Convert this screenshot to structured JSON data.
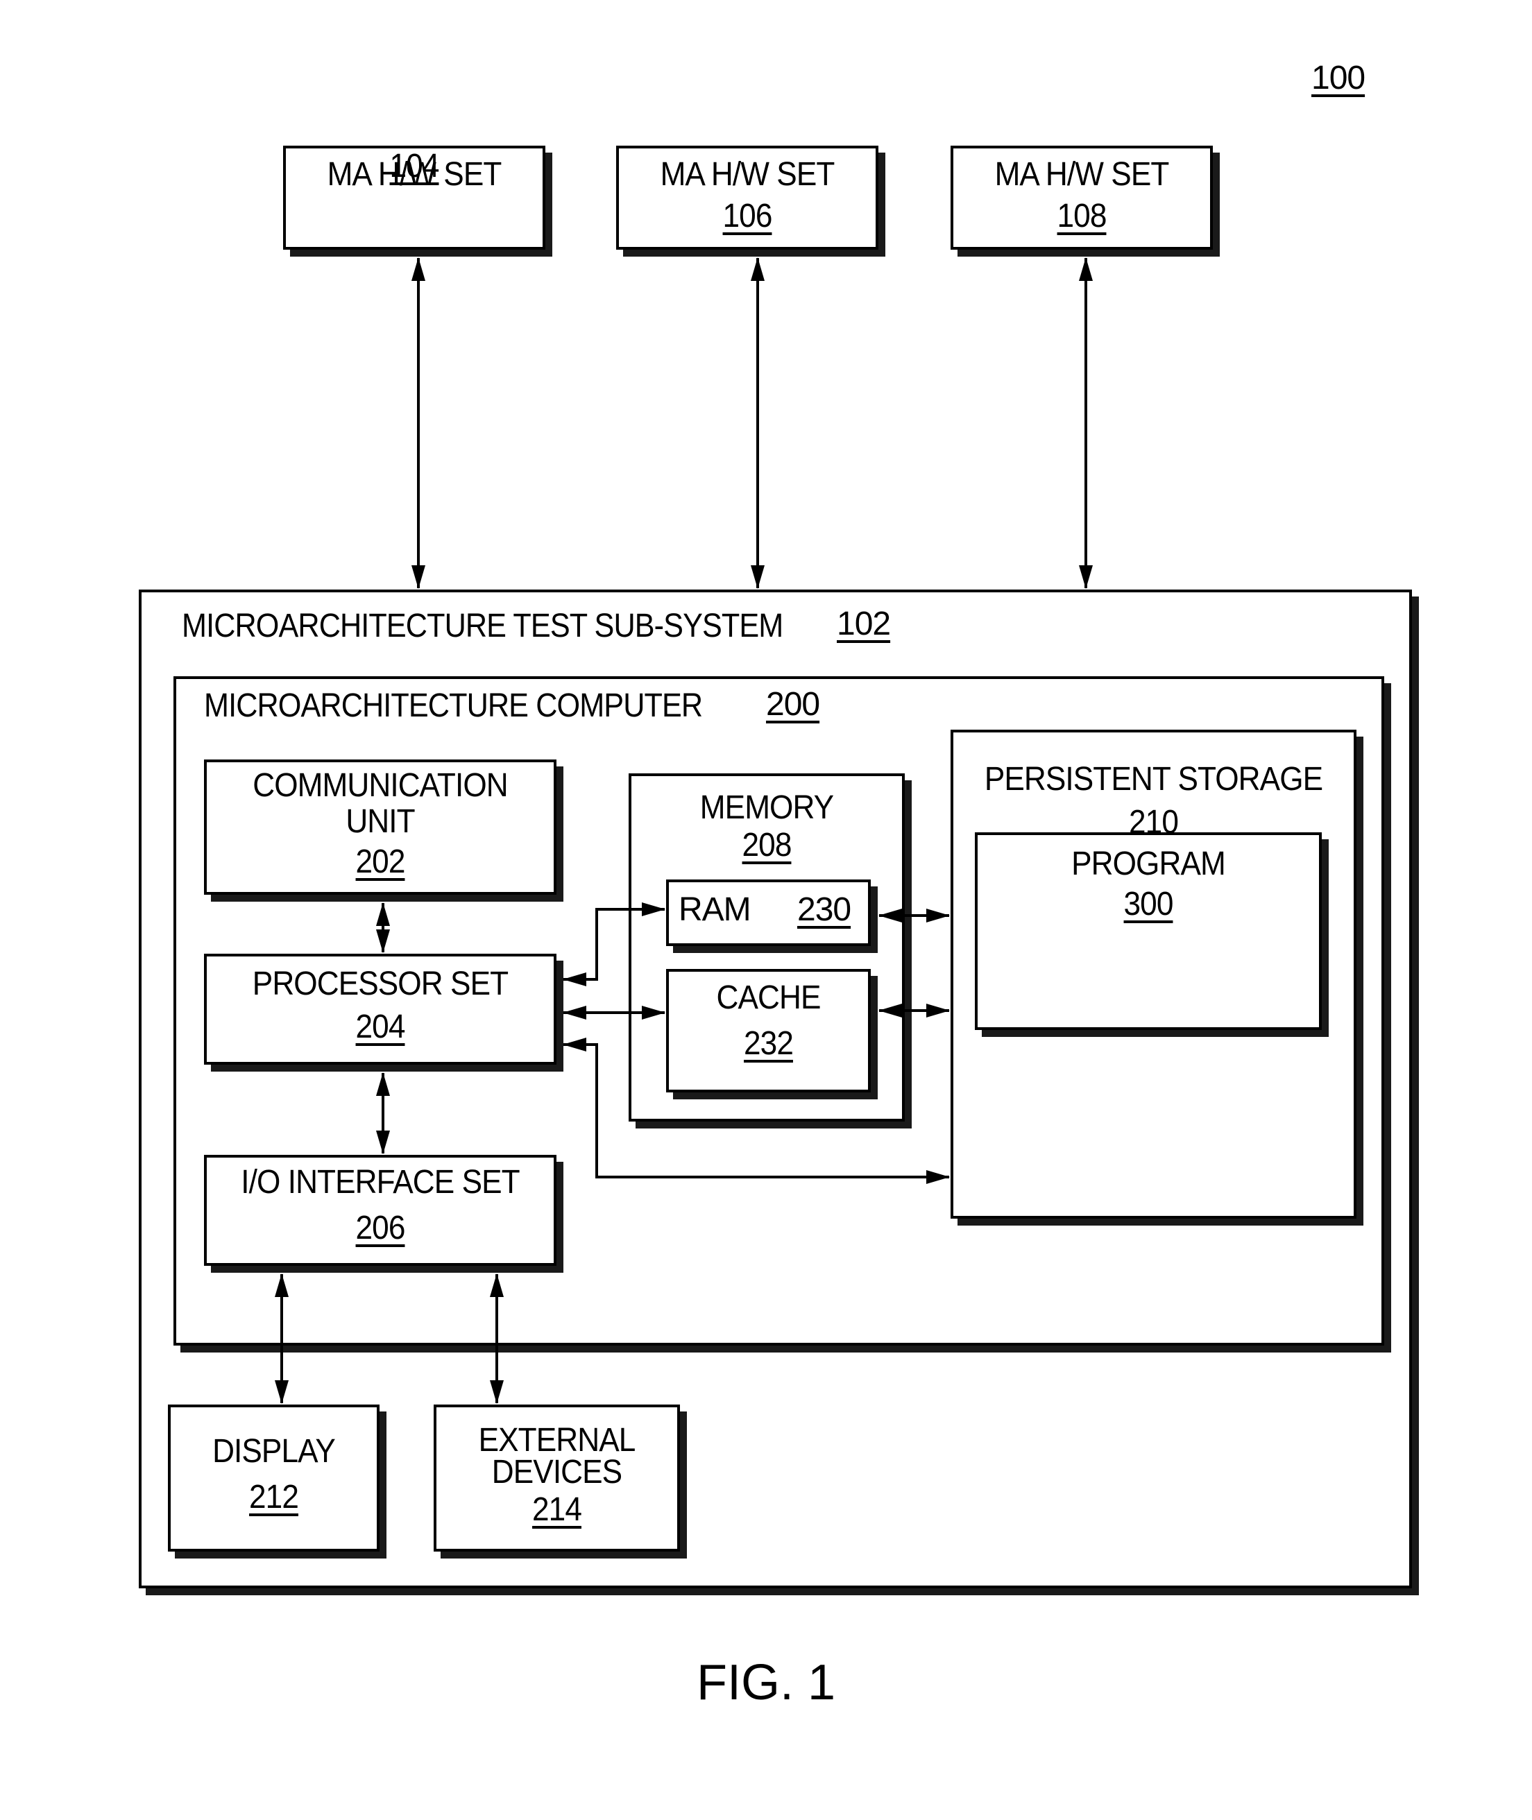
{
  "figure": {
    "ref": "100",
    "caption": "FIG. 1"
  },
  "hw_sets": [
    {
      "label": "MA H/W SET",
      "ref": "104"
    },
    {
      "label": "MA H/W SET",
      "ref": "106"
    },
    {
      "label": "MA H/W SET",
      "ref": "108"
    }
  ],
  "subsystem": {
    "label": "MICROARCHITECTURE TEST SUB-SYSTEM",
    "ref": "102"
  },
  "computer": {
    "label": "MICROARCHITECTURE COMPUTER",
    "ref": "200"
  },
  "comm_unit": {
    "line1": "COMMUNICATION",
    "line2": "UNIT",
    "ref": "202"
  },
  "processor_set": {
    "label": "PROCESSOR SET",
    "ref": "204"
  },
  "io_interface": {
    "label": "I/O INTERFACE SET",
    "ref": "206"
  },
  "memory": {
    "label": "MEMORY",
    "ref": "208"
  },
  "ram": {
    "label": "RAM",
    "ref": "230"
  },
  "cache": {
    "label": "CACHE",
    "ref": "232"
  },
  "persistent_storage": {
    "label": "PERSISTENT STORAGE",
    "ref": "210"
  },
  "program": {
    "label": "PROGRAM",
    "ref": "300"
  },
  "display": {
    "label": "DISPLAY",
    "ref": "212"
  },
  "external_devices": {
    "line1": "EXTERNAL",
    "line2": "DEVICES",
    "ref": "214"
  }
}
